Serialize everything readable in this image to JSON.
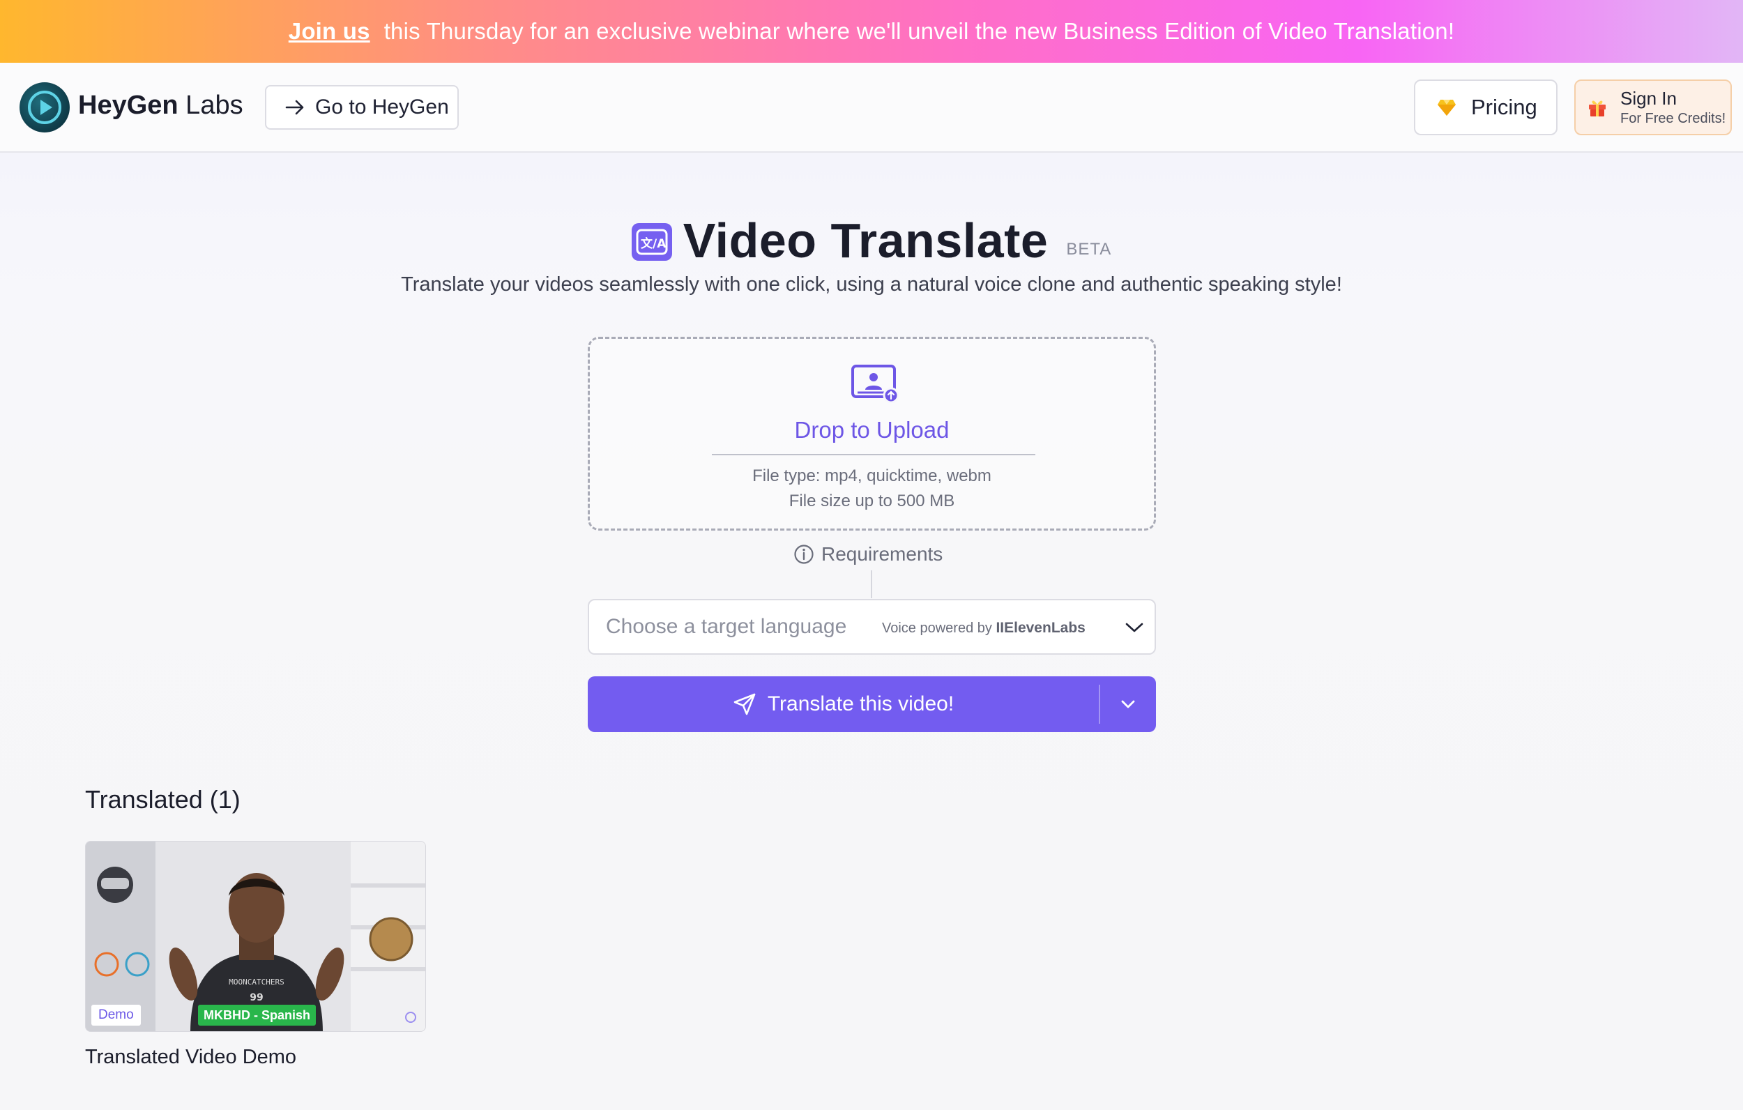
{
  "banner": {
    "link": "Join us",
    "text": "this Thursday for an exclusive webinar where we'll unveil the new Business Edition of Video Translation!"
  },
  "header": {
    "logo_bold": "HeyGen",
    "logo_light": " Labs",
    "go_button": "Go to HeyGen",
    "pricing_button": "Pricing",
    "signin_title": "Sign In",
    "signin_subtitle": "For Free Credits!"
  },
  "hero": {
    "title": "Video Translate",
    "badge": "BETA",
    "subtitle": "Translate your videos seamlessly with one click, using a natural voice clone and authentic speaking style!"
  },
  "upload": {
    "title": "Drop to Upload",
    "file_type": "File type: mp4, quicktime, webm",
    "file_size": "File size up to 500 MB",
    "requirements": "Requirements"
  },
  "language_select": {
    "placeholder": "Choose a target language",
    "voice_powered_prefix": "Voice powered by ",
    "voice_provider": "IIElevenLabs"
  },
  "translate_button": {
    "label": "Translate this video!"
  },
  "translated": {
    "heading": "Translated (1)",
    "videos": [
      {
        "badge_demo": "Demo",
        "badge_lang": "MKBHD - Spanish",
        "shirt_text": "MOONCATCHERS",
        "shirt_number": "99",
        "title": "Translated Video Demo"
      }
    ]
  },
  "colors": {
    "accent": "#735cf0",
    "accent_text": "#6d56e6",
    "lang_badge": "#29b64b",
    "signin_bg": "#fdf0e6"
  },
  "icons": {
    "logo": "heygen-play-logo",
    "go": "arrow-right-icon",
    "pricing": "gem-icon",
    "signin": "gift-icon",
    "title": "translate-icon",
    "upload": "video-upload-icon",
    "requirements": "info-icon",
    "dropdown": "chevron-down-icon",
    "send": "paper-plane-icon"
  }
}
